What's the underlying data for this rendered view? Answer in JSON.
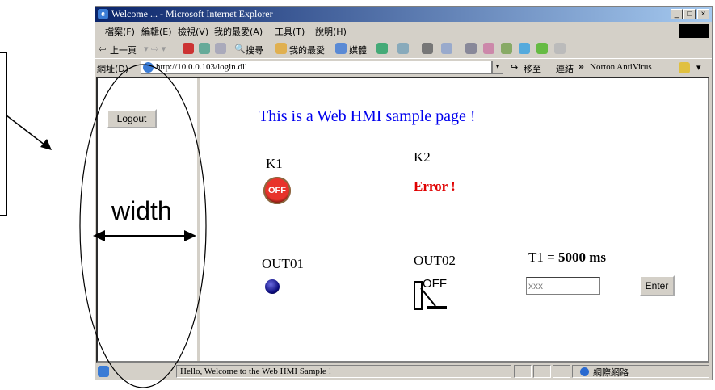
{
  "window": {
    "title": "Welcome ... - Microsoft Internet Explorer",
    "controls": [
      "_",
      "□",
      "×"
    ]
  },
  "menu": [
    "檔案(F)",
    "編輯(E)",
    "檢視(V)",
    "我的最愛(A)",
    "工具(T)",
    "說明(H)"
  ],
  "toolbar": {
    "back_label": "上一頁",
    "search_label": "搜尋",
    "favorites_label": "我的最愛",
    "media_label": "媒體"
  },
  "address": {
    "label": "網址(D)",
    "url": "http://10.0.0.103/login.dll",
    "go_label": "移至",
    "links_label": "連結",
    "chevron": "»",
    "norton_label": "Norton AntiVirus"
  },
  "left_frame": {
    "logout_label": "Logout"
  },
  "main": {
    "title": "This is a Web HMI sample page !",
    "k1_label": "K1",
    "k1_lamp_text": "OFF",
    "k2_label": "K2",
    "k2_status": "Error !",
    "out01_label": "OUT01",
    "out02_label": "OUT02",
    "out02_switch_text": "OFF",
    "t1_label_prefix": "T1 =",
    "t1_value": "5000 ms",
    "t1_input_value": "xxx",
    "enter_label": "Enter"
  },
  "status": {
    "text": "Hello, Welcome to the Web HMI Sample !",
    "zone": "網際網路"
  },
  "annotation": {
    "width_label": "width"
  },
  "colors": {
    "title_blue": "#0000ee",
    "error_red": "#e00000",
    "titlebar_start": "#0a246a"
  }
}
